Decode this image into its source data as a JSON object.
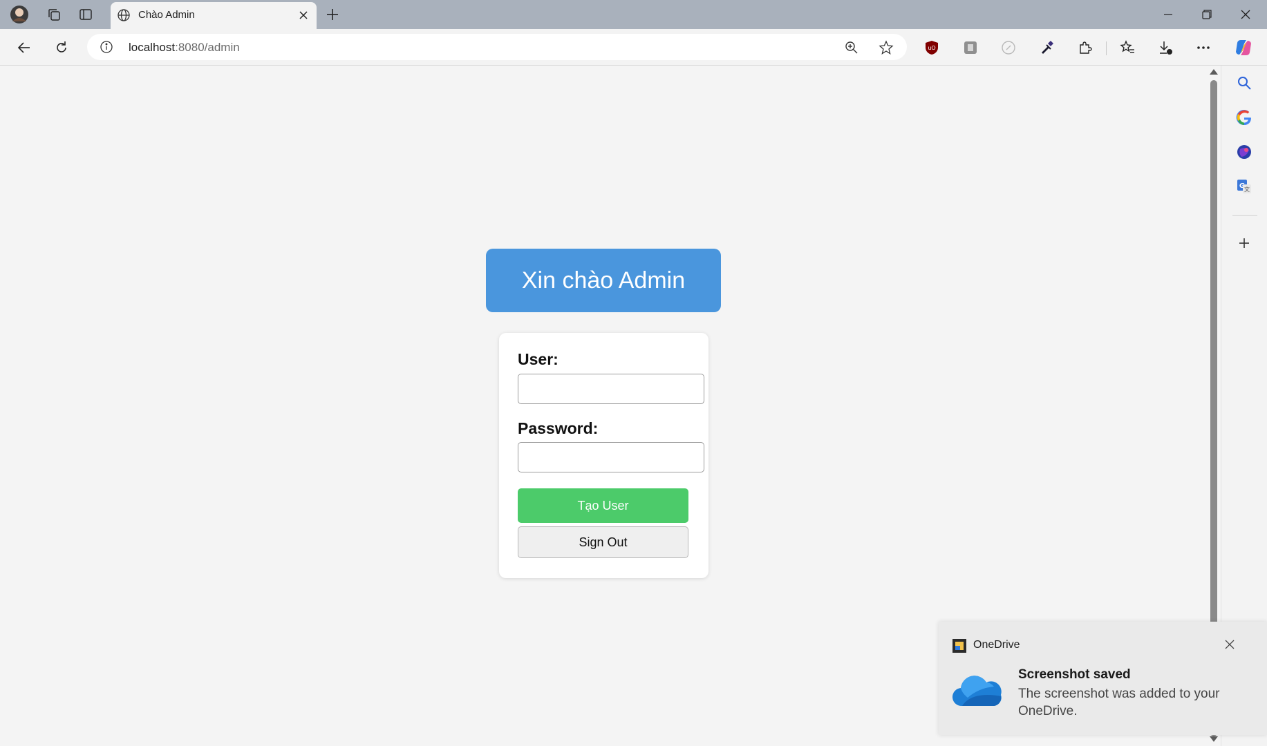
{
  "browser": {
    "tab": {
      "title": "Chào Admin"
    },
    "address": {
      "host": "localhost",
      "path": ":8080/admin"
    }
  },
  "page": {
    "greeting": "Xin chào Admin",
    "form": {
      "user_label": "User:",
      "user_value": "",
      "password_label": "Password:",
      "password_value": "",
      "create_button": "Tạo User",
      "signout_button": "Sign Out"
    }
  },
  "notification": {
    "app": "OneDrive",
    "title": "Screenshot saved",
    "body": "The screenshot was added to your OneDrive."
  },
  "colors": {
    "greeting_bg": "#4a96dd",
    "create_button_bg": "#4ccb6a",
    "titlebar_bg": "#a9b1bc"
  },
  "icons": {
    "titlebar": [
      "profile-avatar-icon",
      "workspaces-icon",
      "vertical-tabs-icon"
    ],
    "toolbar": [
      "back-icon",
      "refresh-icon",
      "info-icon",
      "zoom-icon",
      "favorite-star-icon",
      "ublock-icon",
      "extension-icon",
      "compass-icon",
      "eyedropper-icon",
      "puzzle-icon",
      "favorites-icon",
      "downloads-icon",
      "more-icon",
      "copilot-icon"
    ],
    "sidebar": [
      "search-icon",
      "google-icon",
      "shopping-icon",
      "translate-icon",
      "add-icon"
    ]
  }
}
